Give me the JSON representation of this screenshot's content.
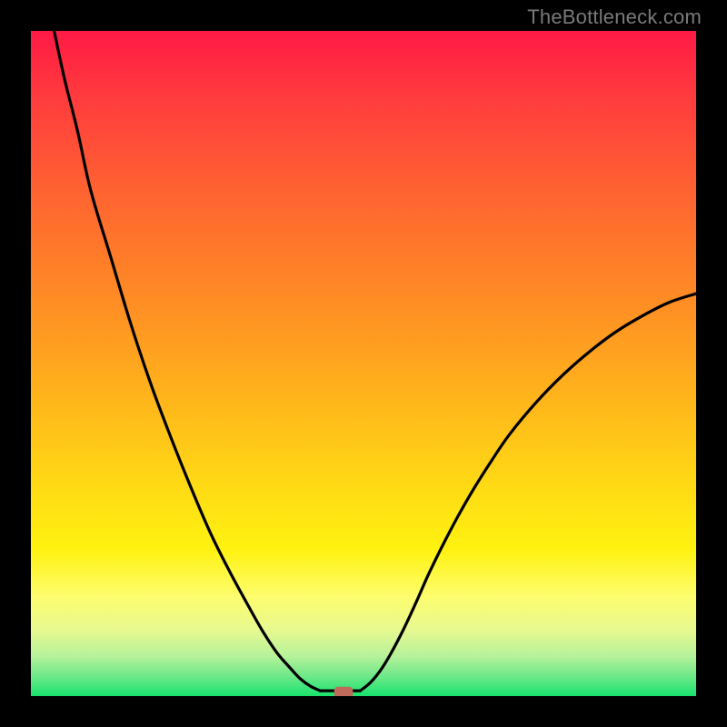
{
  "chart_data": {
    "type": "line",
    "title": "",
    "xlabel": "",
    "ylabel": "",
    "xlim": [
      0,
      100
    ],
    "ylim": [
      0,
      100
    ],
    "grid": false,
    "watermark": "TheBottleneck.com",
    "curves": [
      {
        "name": "left-branch",
        "description": "Steeply descending curve from top-left corner toward the valley minimum",
        "points": [
          [
            3.5,
            100
          ],
          [
            5,
            93
          ],
          [
            7,
            85
          ],
          [
            9,
            76
          ],
          [
            12,
            66
          ],
          [
            15,
            56
          ],
          [
            18,
            47
          ],
          [
            21,
            39
          ],
          [
            24,
            31.5
          ],
          [
            27,
            24.5
          ],
          [
            30,
            18.5
          ],
          [
            33,
            13
          ],
          [
            35,
            9.5
          ],
          [
            37,
            6.5
          ],
          [
            39,
            4.2
          ],
          [
            40.5,
            2.6
          ],
          [
            42,
            1.5
          ],
          [
            43.5,
            0.8
          ]
        ]
      },
      {
        "name": "valley-flat",
        "description": "Flat bottom of the V-curve along y≈0",
        "points": [
          [
            43.5,
            0.8
          ],
          [
            45.5,
            0.8
          ],
          [
            47.5,
            0.8
          ],
          [
            49.5,
            0.8
          ]
        ]
      },
      {
        "name": "right-branch",
        "description": "Rising curve from valley minimum toward upper-right, tapering to ~60%",
        "points": [
          [
            49.5,
            0.8
          ],
          [
            51,
            2.0
          ],
          [
            52.5,
            3.8
          ],
          [
            54,
            6.2
          ],
          [
            56,
            10.0
          ],
          [
            58,
            14.3
          ],
          [
            60,
            18.8
          ],
          [
            63,
            24.8
          ],
          [
            66,
            30.2
          ],
          [
            69,
            35.0
          ],
          [
            72,
            39.4
          ],
          [
            76,
            44.2
          ],
          [
            80,
            48.3
          ],
          [
            84,
            51.8
          ],
          [
            88,
            54.8
          ],
          [
            92,
            57.2
          ],
          [
            96,
            59.2
          ],
          [
            100,
            60.5
          ]
        ]
      }
    ],
    "marker": {
      "name": "min-marker",
      "shape": "rounded-rect",
      "color": "#c06a5c",
      "x": 47,
      "y": 0.4,
      "half_width_pct": 1.4,
      "half_height_pct": 1.0,
      "description": "Small rounded brick/pink marker at the valley minimum"
    }
  }
}
